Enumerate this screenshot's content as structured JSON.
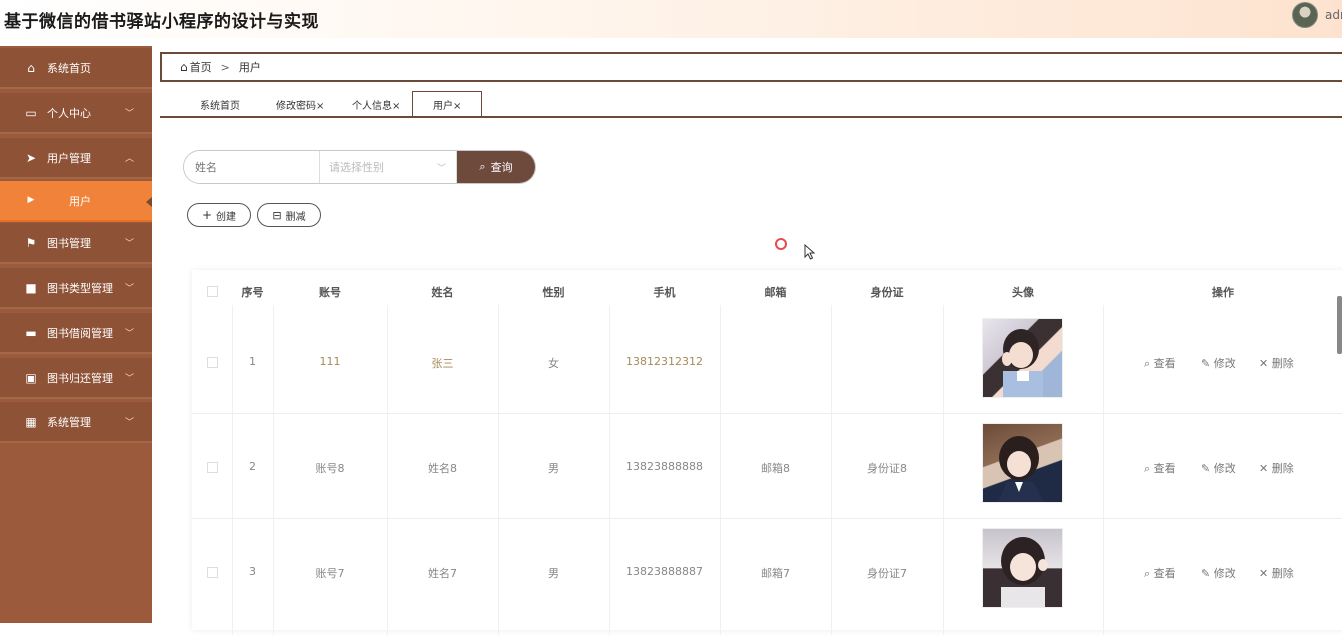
{
  "header": {
    "app_title": "基于微信的借书驿站小程序的设计与实现",
    "user_name": "admin"
  },
  "sidebar": {
    "items": [
      {
        "label": "系统首页",
        "icon": "home-icon"
      },
      {
        "label": "个人中心",
        "icon": "card-icon"
      },
      {
        "label": "用户管理",
        "icon": "send-icon"
      },
      {
        "label": "用户",
        "icon": "caret-right-icon"
      },
      {
        "label": "图书管理",
        "icon": "flag-icon"
      },
      {
        "label": "图书类型管理",
        "icon": "chat-icon"
      },
      {
        "label": "图书借阅管理",
        "icon": "ticket-icon"
      },
      {
        "label": "图书归还管理",
        "icon": "clipboard-icon"
      },
      {
        "label": "系统管理",
        "icon": "grid-icon"
      }
    ]
  },
  "breadcrumb": {
    "home": "首页",
    "separator": ">",
    "current": "用户"
  },
  "tabs": [
    {
      "label": "系统首页"
    },
    {
      "label": "修改密码×"
    },
    {
      "label": "个人信息×"
    },
    {
      "label": "用户×"
    }
  ],
  "search": {
    "name_placeholder": "姓名",
    "gender_placeholder": "请选择性别",
    "query_label": "查询"
  },
  "actions": {
    "create_label": "创建",
    "delete_label": "删减"
  },
  "table": {
    "columns": [
      "序号",
      "账号",
      "姓名",
      "性别",
      "手机",
      "邮箱",
      "身份证",
      "头像",
      "操作"
    ],
    "rows": [
      {
        "index": "1",
        "account": "111",
        "name": "张三",
        "gender": "女",
        "phone": "13812312312",
        "email": "",
        "id_card": ""
      },
      {
        "index": "2",
        "account": "账号8",
        "name": "姓名8",
        "gender": "男",
        "phone": "13823888888",
        "email": "邮箱8",
        "id_card": "身份证8"
      },
      {
        "index": "3",
        "account": "账号7",
        "name": "姓名7",
        "gender": "男",
        "phone": "13823888887",
        "email": "邮箱7",
        "id_card": "身份证7"
      }
    ],
    "row_actions": {
      "view": "查看",
      "edit": "修改",
      "delete": "删除"
    }
  },
  "colors": {
    "accent": "#f0823a",
    "sidebar": "#9a5a3b",
    "primary_button": "#6e4a3c"
  }
}
